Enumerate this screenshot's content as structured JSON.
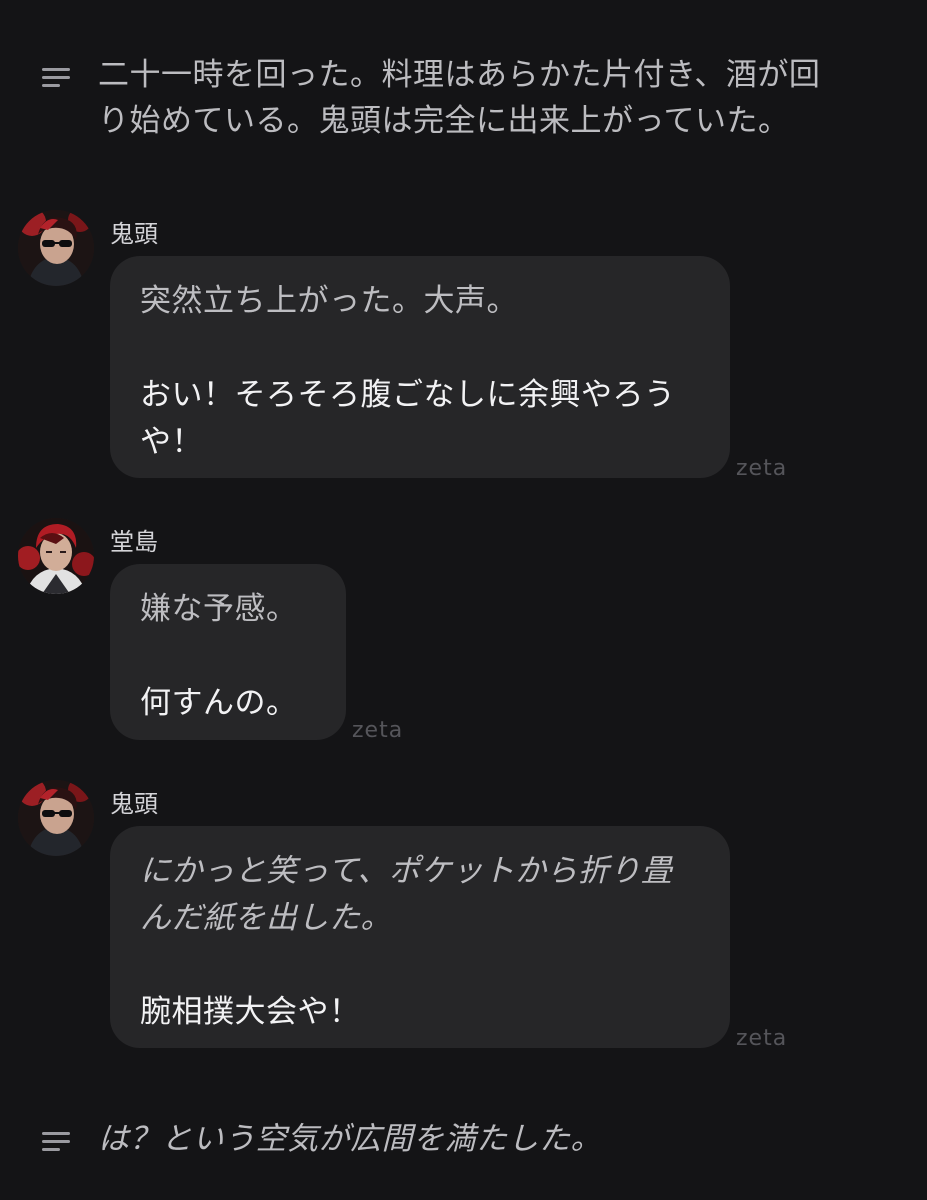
{
  "narration_top": {
    "icon": "narration-lines-icon",
    "line1": "二十一時を回った。料理はあらかた片付き、酒が回",
    "line2": "り始めている。鬼頭は完全に出来上がっていた。"
  },
  "messages": [
    {
      "name": "鬼頭",
      "avatar": "character-avatar-kito",
      "lines": [
        "突然立ち上がった。大声。"
      ],
      "speech": [
        "おい！そろそろ腹ごなしに余興やろう",
        "や！"
      ],
      "watermark": "zeta"
    },
    {
      "name": "堂島",
      "avatar": "character-avatar-dojima",
      "lines": [
        "嫌な予感。"
      ],
      "speech": [
        "何すんの。"
      ],
      "watermark": "zeta"
    },
    {
      "name": "鬼頭",
      "avatar": "character-avatar-kito",
      "lines": [
        "にかっと笑って、ポケットから折り畳",
        "んだ紙を出した。"
      ],
      "speech": [
        "腕相撲大会や！"
      ],
      "watermark": "zeta"
    }
  ],
  "narration_bottom": {
    "icon": "narration-lines-icon",
    "line1": "は？という空気が広間を満たした。"
  },
  "colors": {
    "background": "#141416",
    "bubble": "#262628",
    "narration_text": "#bcbcc0",
    "watermark": "#55555a"
  }
}
